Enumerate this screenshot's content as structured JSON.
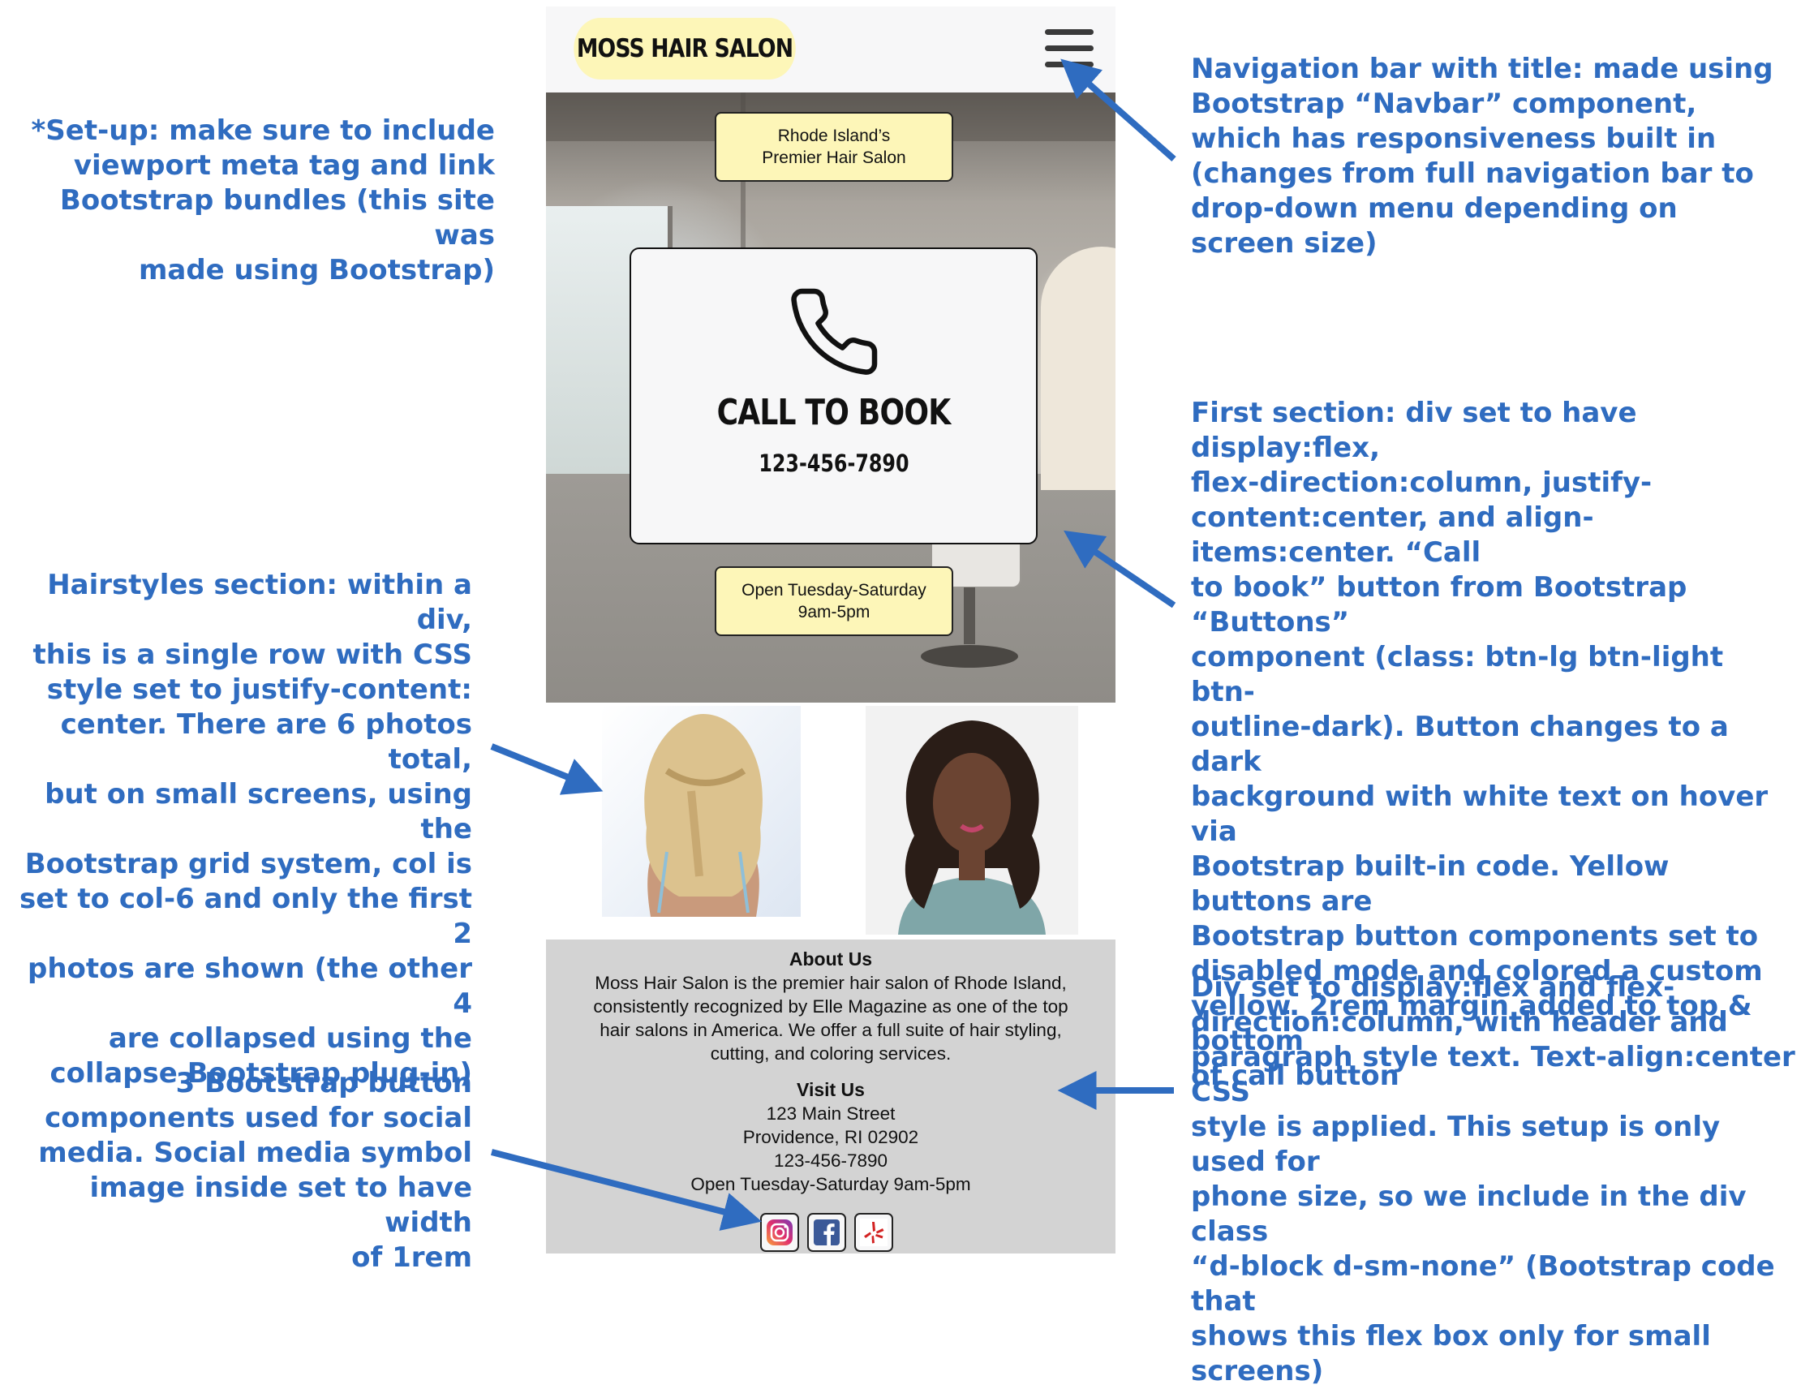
{
  "phone": {
    "navbar": {
      "brand": "MOSS HAIR SALON"
    },
    "hero": {
      "tagline_line1": "Rhode Island’s",
      "tagline_line2": "Premier Hair Salon",
      "call_label": "CALL TO BOOK",
      "call_phone": "123-456-7890",
      "hours_line1": "Open Tuesday-Saturday",
      "hours_line2": "9am-5pm"
    },
    "about": {
      "about_heading": "About Us",
      "about_lines": [
        "Moss Hair Salon is the premier hair salon of Rhode Island,",
        "consistently recognized by Elle Magazine as one of the top",
        "hair salons in America. We offer a full suite of hair styling,",
        "cutting, and coloring services."
      ],
      "visit_heading": "Visit Us",
      "visit_lines": [
        "123 Main Street",
        "Providence, RI 02902",
        "123-456-7890",
        "Open Tuesday-Saturday 9am-5pm"
      ]
    },
    "social": [
      {
        "icon": "instagram-icon"
      },
      {
        "icon": "facebook-icon"
      },
      {
        "icon": "yelp-icon"
      }
    ]
  },
  "annotations": {
    "setup": [
      "*Set-up: make sure to include",
      "viewport meta tag and link",
      "Bootstrap bundles (this site was",
      "made using Bootstrap)"
    ],
    "navbar": [
      "Navigation bar with title: made using",
      "Bootstrap “Navbar” component,",
      "which has responsiveness built in",
      "(changes from full navigation bar to",
      "drop-down menu depending on",
      "screen size)"
    ],
    "first_section": [
      "First section: div set to have display:flex,",
      "flex-direction:column, justify-",
      "content:center, and align-items:center. “Call",
      "to book” button from Bootstrap “Buttons”",
      "component (class: btn-lg btn-light btn-",
      "outline-dark). Button changes to a dark",
      "background with white text on hover via",
      "Bootstrap built-in code. Yellow buttons are",
      "Bootstrap button components set to",
      "disabled mode and colored a custom",
      "yellow. 2rem margin added to top & bottom",
      "of call button"
    ],
    "hairstyles": [
      "Hairstyles section: within a div,",
      "this is a single row with CSS",
      "style set to  justify-content:",
      "center. There are 6 photos total,",
      "but on small screens, using the",
      "Bootstrap grid system, col is",
      "set to col-6 and only the first 2",
      "photos are shown (the other 4",
      "are collapsed using the",
      "collapse Bootstrap plug-in)"
    ],
    "div_flex": [
      "Div set to display:flex and flex-",
      "direction:column, with header and",
      "paragraph style text. Text-align:center CSS",
      "style is applied. This setup is only used for",
      "phone size, so we include in the div class",
      "“d-block d-sm-none” (Bootstrap code that",
      "shows this flex box only for small screens)"
    ],
    "social": [
      "3 Bootstrap button",
      "components used for social",
      "media. Social media symbol",
      "image inside set to have width",
      "of 1rem"
    ]
  },
  "colors": {
    "annotation_blue": "#2f6cc0",
    "brand_yellow": "#fdf6b8",
    "about_gray": "#d3d3d3",
    "navbar_bg": "#f7f7f8"
  }
}
